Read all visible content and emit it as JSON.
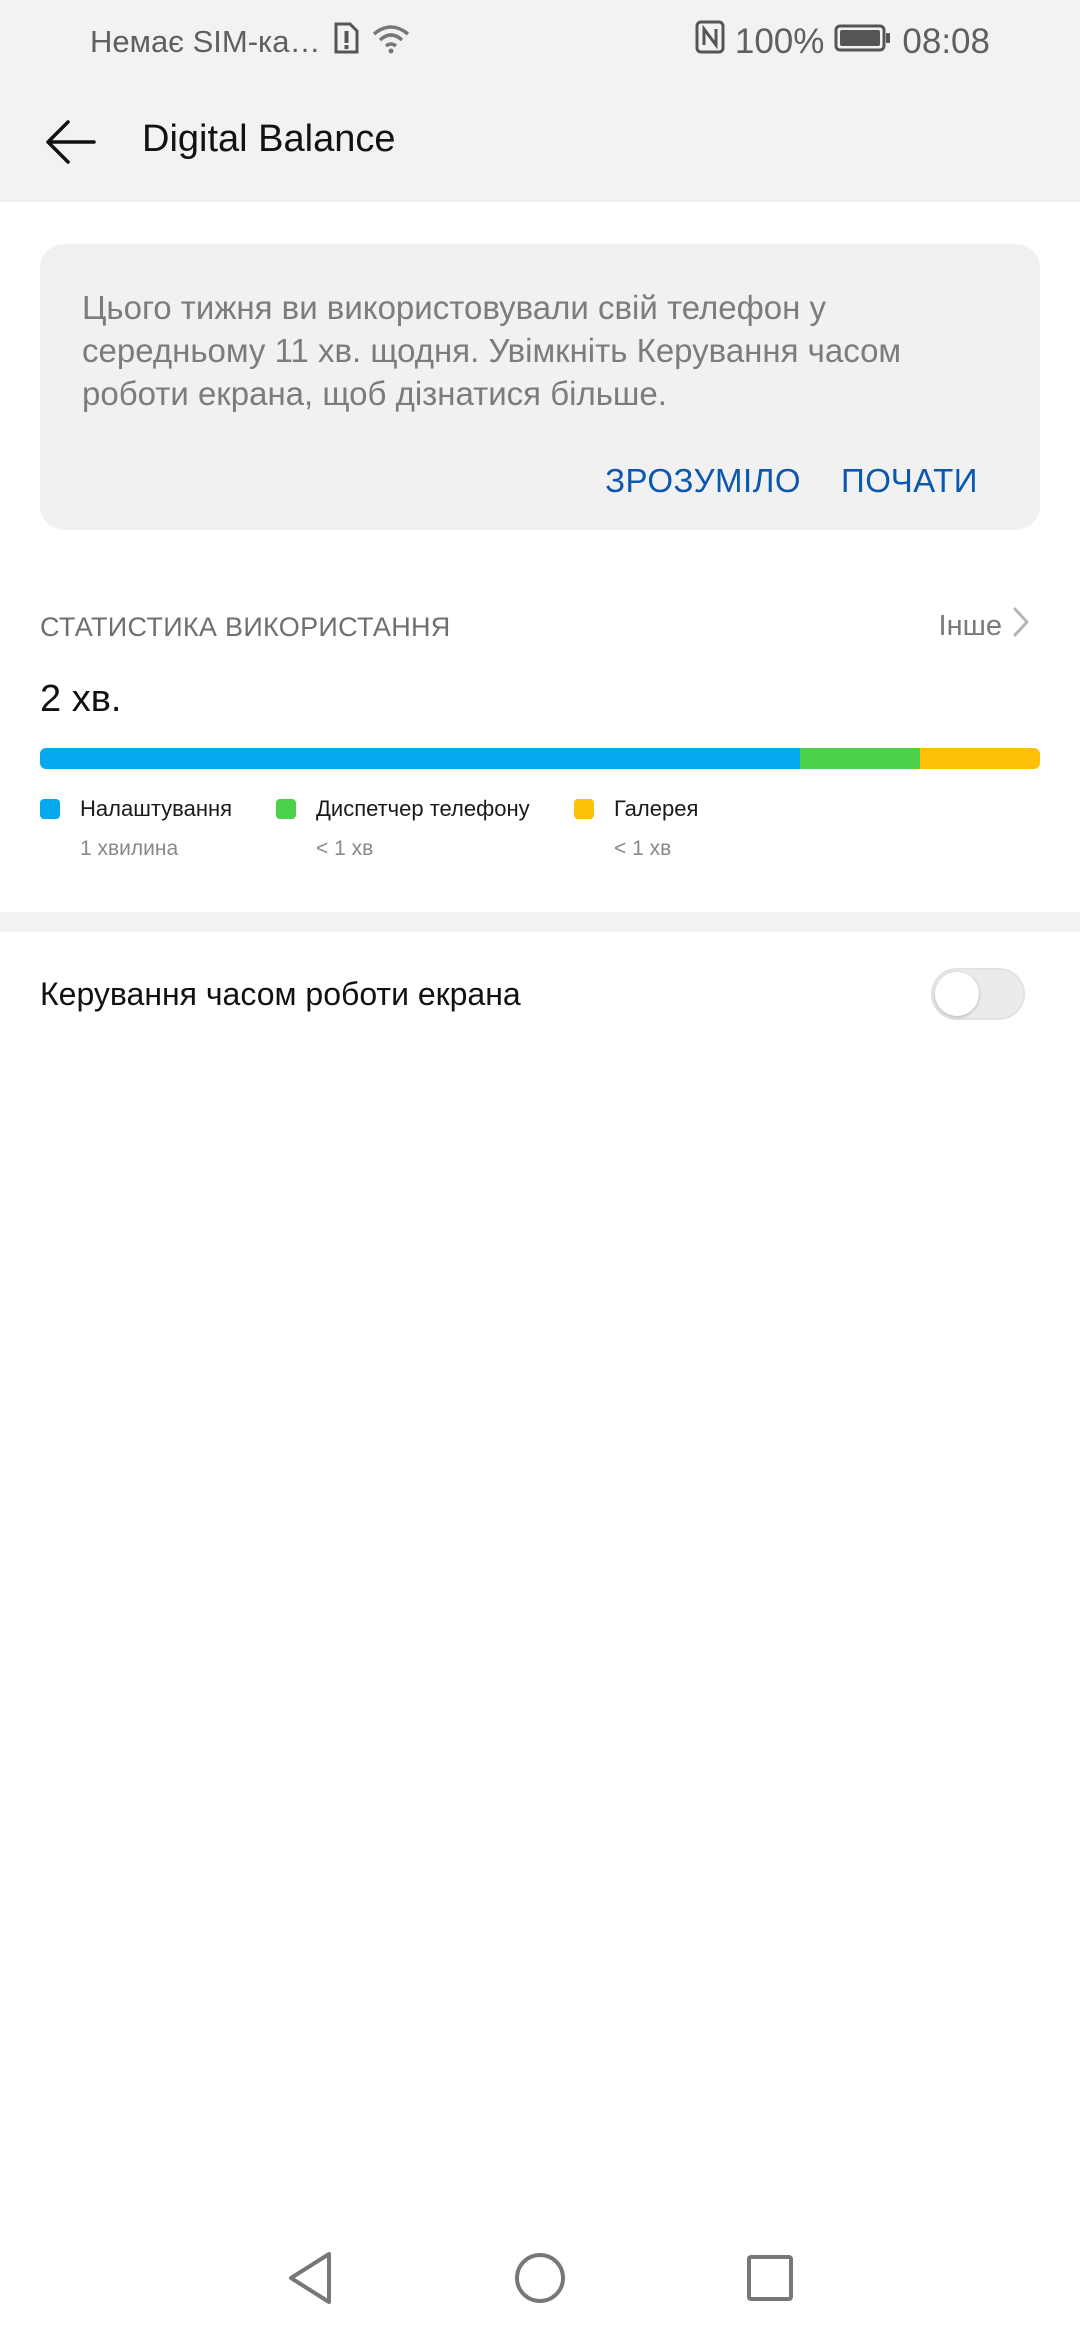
{
  "status_bar": {
    "sim_text": "Немає SIM-ка…",
    "battery": "100%",
    "time": "08:08",
    "icons": [
      "sim-alert-icon",
      "wifi-icon",
      "nfc-icon",
      "battery-icon"
    ]
  },
  "app_bar": {
    "title": "Digital Balance",
    "back_icon": "back-arrow-icon"
  },
  "notice": {
    "text": "Цього тижня ви використовували свій телефон у середньому 11 хв. щодня. Увімкніть Керування часом роботи екрана, щоб дізнатися більше.",
    "dismiss_label": "ЗРОЗУМІЛО",
    "start_label": "ПОЧАТИ"
  },
  "usage": {
    "section_title": "СТАТИСТИКА ВИКОРИСТАННЯ",
    "more_label": "Інше",
    "total": "2 хв.",
    "segments": [
      {
        "label": "Налаштування",
        "sub": "1 хвилина",
        "color": "#06a8ee",
        "share": 0.76
      },
      {
        "label": "Диспетчер телефону",
        "sub": "< 1 хв",
        "color": "#4cd14d",
        "share": 0.12
      },
      {
        "label": "Галерея",
        "sub": "< 1 хв",
        "color": "#ffc107",
        "share": 0.12
      }
    ]
  },
  "screen_time": {
    "label": "Керування часом роботи екрана",
    "enabled": false
  },
  "nav_bar": {
    "icons": [
      "back-triangle-icon",
      "home-circle-icon",
      "recents-square-icon"
    ]
  },
  "colors": {
    "accent": "#0a57b0",
    "surface": "#f2f2f2"
  }
}
